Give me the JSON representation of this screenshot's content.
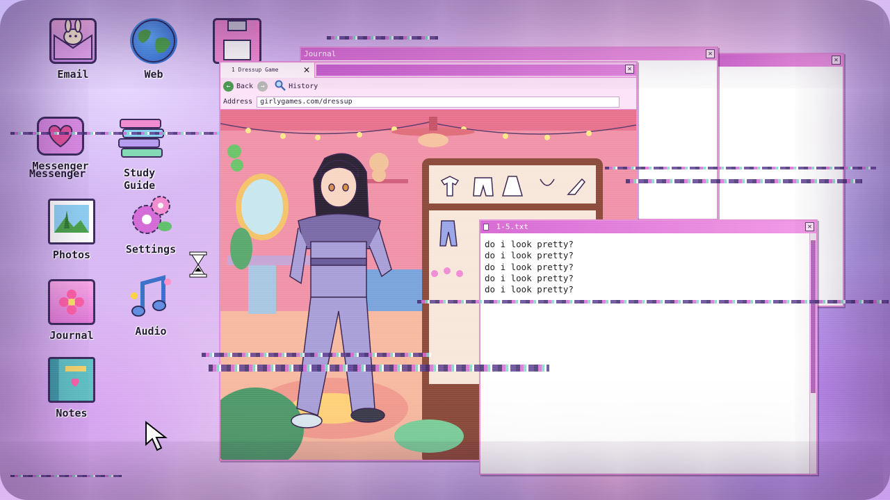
{
  "desktop": {
    "icons": [
      {
        "label": "Email"
      },
      {
        "label": "Web"
      },
      {
        "label": "Messenger"
      },
      {
        "label": "Study\nGuide"
      },
      {
        "label": "Photos"
      },
      {
        "label": "Settings"
      },
      {
        "label": "Journal"
      },
      {
        "label": "Audio"
      },
      {
        "label": "Notes"
      }
    ],
    "messenger_ghost_label": "Messenger"
  },
  "journal_window": {
    "title": "Journal"
  },
  "browser": {
    "tab_label": "1 Dressup Game",
    "back_label": "Back",
    "history_label": "History",
    "address_label": "Address",
    "address_value": "girlygames.com/dressup"
  },
  "text_window": {
    "title": "1-5.txt",
    "lines": [
      "do i look pretty?",
      "do i look pretty?",
      "do i look pretty?",
      "do i look pretty?",
      "do i look pretty?"
    ]
  },
  "colors": {
    "titlebar": "#d66ad3",
    "window_border": "#e58fd9",
    "back_button": "#4c9a52",
    "forward_button": "#b9b9b9",
    "history_icon": "#4468b8"
  }
}
